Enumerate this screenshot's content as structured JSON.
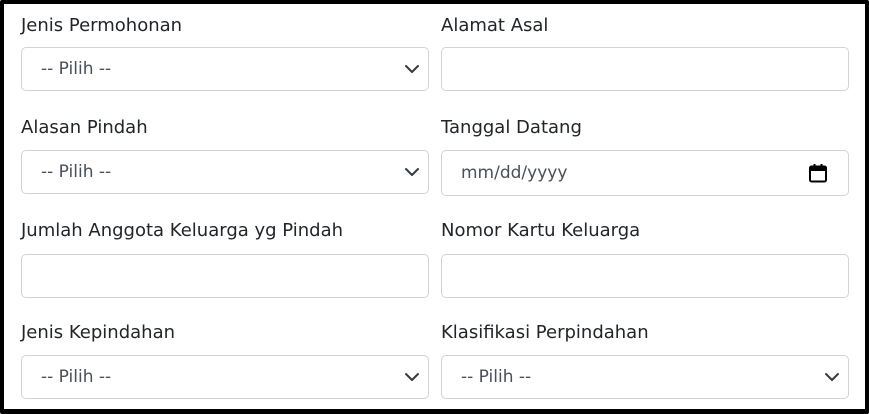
{
  "form": {
    "jenis_permohonan": {
      "label": "Jenis Permohonan",
      "value": "-- Pilih --"
    },
    "alamat_asal": {
      "label": "Alamat Asal",
      "value": ""
    },
    "alasan_pindah": {
      "label": "Alasan Pindah",
      "value": "-- Pilih --"
    },
    "tanggal_datang": {
      "label": "Tanggal Datang",
      "value": "mm/dd/yyyy"
    },
    "jumlah_anggota": {
      "label": "Jumlah Anggota Keluarga yg Pindah",
      "value": ""
    },
    "nomor_kk": {
      "label": "Nomor Kartu Keluarga",
      "value": ""
    },
    "jenis_kepindahan": {
      "label": "Jenis Kepindahan",
      "value": "-- Pilih --"
    },
    "klasifikasi_perpindahan": {
      "label": "Klasifikasi Perpindahan",
      "value": "-- Pilih --"
    }
  },
  "icons": {
    "select_arrow": "chevron-down-icon",
    "date_picker": "calendar-icon"
  },
  "colors": {
    "label_text": "#212529",
    "value_text": "#495057",
    "input_border": "#ced4da",
    "frame_border": "#000000"
  }
}
